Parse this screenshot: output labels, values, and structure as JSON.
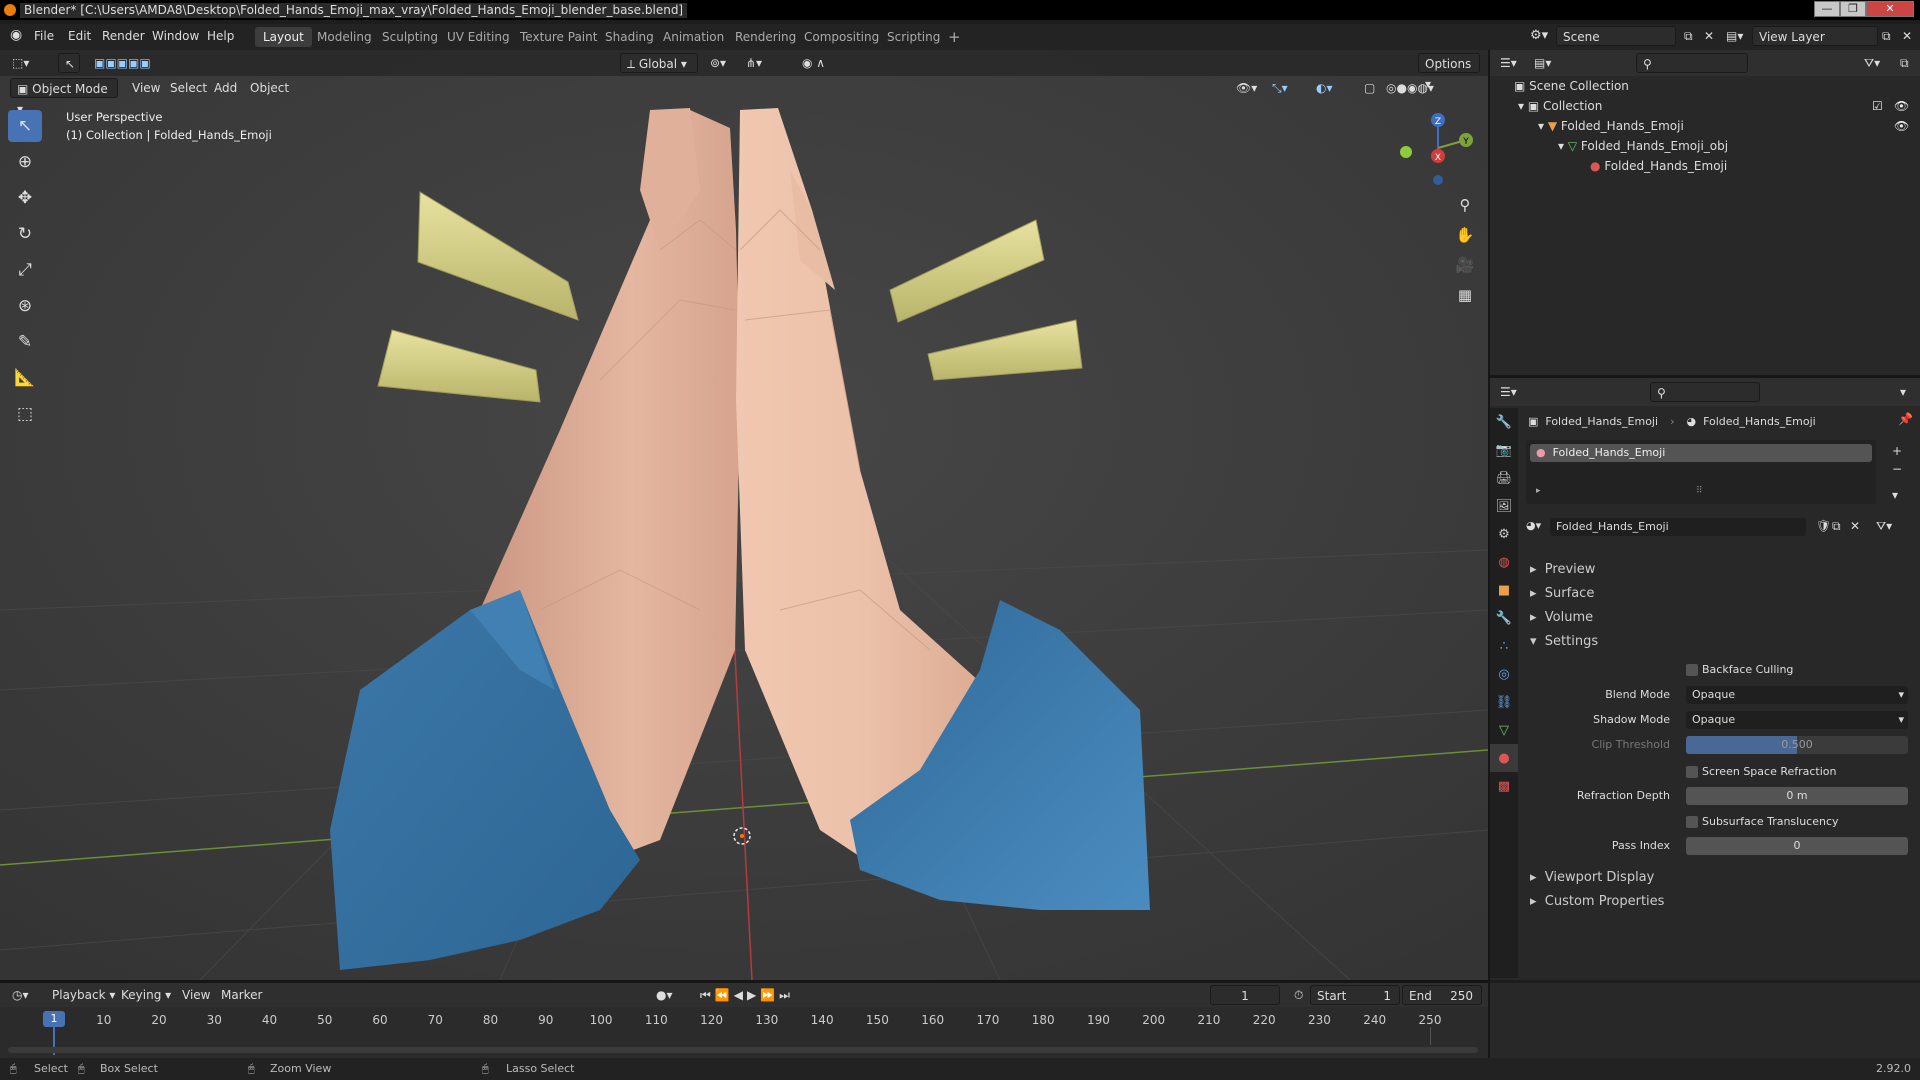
{
  "window": {
    "title": "Blender* [C:\\Users\\AMDA8\\Desktop\\Folded_Hands_Emoji_max_vray\\Folded_Hands_Emoji_blender_base.blend]"
  },
  "menubar": {
    "menus": [
      "File",
      "Edit",
      "Render",
      "Window",
      "Help"
    ],
    "workspaces": [
      "Layout",
      "Modeling",
      "Sculpting",
      "UV Editing",
      "Texture Paint",
      "Shading",
      "Animation",
      "Rendering",
      "Compositing",
      "Scripting"
    ],
    "active_workspace": "Layout",
    "add_tab": "+",
    "scene": "Scene",
    "view_layer": "View Layer"
  },
  "viewport": {
    "transform_orientation": "Global",
    "options": "Options",
    "mode": "Object Mode",
    "header_menus": [
      "View",
      "Select",
      "Add",
      "Object"
    ],
    "perspective": "User Perspective",
    "collection_info": "(1) Collection | Folded_Hands_Emoji",
    "axes": {
      "x": "X",
      "y": "Y",
      "z": "Z"
    }
  },
  "outliner": {
    "items": [
      {
        "label": "Scene Collection"
      },
      {
        "label": "Collection"
      },
      {
        "label": "Folded_Hands_Emoji"
      },
      {
        "label": "Folded_Hands_Emoji_obj"
      },
      {
        "label": "Folded_Hands_Emoji"
      }
    ]
  },
  "properties": {
    "breadcrumb_object": "Folded_Hands_Emoji",
    "breadcrumb_material": "Folded_Hands_Emoji",
    "slot_name": "Folded_Hands_Emoji",
    "material_name": "Folded_Hands_Emoji",
    "panels": {
      "preview": "Preview",
      "surface": "Surface",
      "volume": "Volume",
      "settings": "Settings",
      "viewport_display": "Viewport Display",
      "custom_properties": "Custom Properties"
    },
    "settings": {
      "backface_culling": "Backface Culling",
      "blend_mode_label": "Blend Mode",
      "blend_mode": "Opaque",
      "shadow_mode_label": "Shadow Mode",
      "shadow_mode": "Opaque",
      "clip_threshold_label": "Clip Threshold",
      "clip_threshold": "0.500",
      "screen_space_refraction": "Screen Space Refraction",
      "refraction_depth_label": "Refraction Depth",
      "refraction_depth": "0 m",
      "subsurface_translucency": "Subsurface Translucency",
      "pass_index_label": "Pass Index",
      "pass_index": "0"
    }
  },
  "timeline": {
    "menus": [
      "Playback",
      "Keying",
      "View",
      "Marker"
    ],
    "current_frame": "1",
    "start_label": "Start",
    "start": "1",
    "end_label": "End",
    "end": "250",
    "ruler": [
      "1",
      "10",
      "20",
      "30",
      "40",
      "50",
      "60",
      "70",
      "80",
      "90",
      "100",
      "110",
      "120",
      "130",
      "140",
      "150",
      "160",
      "170",
      "180",
      "190",
      "200",
      "210",
      "220",
      "230",
      "240",
      "250"
    ]
  },
  "statusbar": {
    "select": "Select",
    "box_select": "Box Select",
    "zoom_view": "Zoom View",
    "lasso_select": "Lasso Select",
    "version": "2.92.0"
  },
  "colors": {
    "accent": "#4772b3",
    "skin": "#e9bfa6",
    "cuff": "#3f7fb4",
    "rays": "#d9d38a",
    "selected": "#e87d0d"
  }
}
